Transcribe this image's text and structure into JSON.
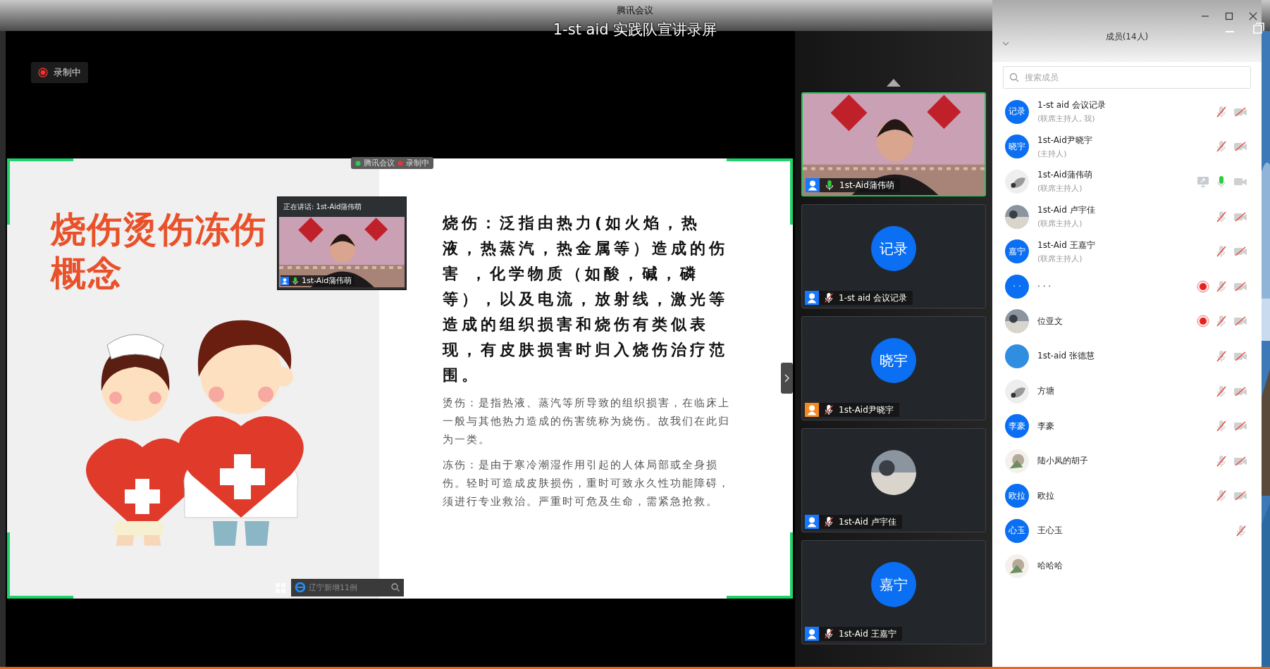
{
  "window": {
    "app_title": "腾讯会议",
    "overlay_title": "1-st aid 实践队宣讲录屏"
  },
  "stage": {
    "recording_badge": "录制中",
    "slide": {
      "title_lines": [
        "烧伤烫伤冻伤",
        "概念"
      ],
      "paragraphs": [
        {
          "kind": "lead",
          "text": "烧伤：泛指由热力(如火焰，热液，热蒸汽，热金属等）造成的伤害 ，化学物质（如酸，碱，磷等），以及电流，放射线，激光等造成的组织损害和烧伤有类似表现，有皮肤损害时归入烧伤治疗范围。"
        },
        {
          "kind": "body",
          "text": "烫伤：是指热液、蒸汽等所导致的组织损害，在临床上一般与其他热力造成的伤害统称为烧伤。故我们在此归为一类。"
        },
        {
          "kind": "body",
          "text": "冻伤：是由于寒冷潮湿作用引起的人体局部或全身损伤。轻时可造成皮肤损伤，重时可致永久性功能障碍，须进行专业救治。严重时可危及生命，需紧急抢救。"
        }
      ]
    },
    "floating_bar": {
      "app": "腾讯会议",
      "status": "录制中"
    },
    "speaker_window": {
      "heading": "正在讲话: 1st-Aid蒲伟萌",
      "name": "1st-Aid蒲伟萌",
      "mic_muted": false
    },
    "taskbar": {
      "search_placeholder": "辽宁新增11例"
    }
  },
  "tiles": [
    {
      "kind": "video",
      "name": "1st-Aid蒲伟萌",
      "mic_muted": false,
      "color": "#1677ff",
      "speaking": true
    },
    {
      "kind": "initials",
      "initials": "记录",
      "name": "1-st aid  会议记录",
      "mic_muted": true,
      "color": "#1677ff",
      "speaking": false
    },
    {
      "kind": "initials",
      "initials": "晓宇",
      "name": "1st-Aid尹晓宇",
      "mic_muted": true,
      "color": "#f5891f",
      "speaking": false
    },
    {
      "kind": "picture",
      "name": "1st-Aid 卢宇佳",
      "mic_muted": true,
      "color": "#1677ff",
      "speaking": false
    },
    {
      "kind": "initials",
      "initials": "嘉宁",
      "name": "1st-Aid 王嘉宁",
      "mic_muted": true,
      "color": "#1677ff",
      "speaking": false
    }
  ],
  "members": {
    "title": "成员(14人)",
    "search": {
      "placeholder": "搜索成员"
    },
    "items": [
      {
        "avatar": {
          "kind": "initials",
          "text": "记录"
        },
        "name": "1-st aid  会议记录",
        "role": "(联席主持人, 我)",
        "sharing": false,
        "recording": false,
        "mic_muted": true,
        "camera_off": true
      },
      {
        "avatar": {
          "kind": "initials",
          "text": "晓宇"
        },
        "name": "1st-Aid尹晓宇",
        "role": "(主持人)",
        "sharing": false,
        "recording": false,
        "mic_muted": true,
        "camera_off": true
      },
      {
        "name": "1st-Aid蒲伟萌",
        "role": "(联席主持人)",
        "sharing": true,
        "recording": false,
        "mic_muted": false,
        "camera_off": false
      },
      {
        "name": "1st-Aid 卢宇佳",
        "role": "(联席主持人)",
        "sharing": false,
        "recording": false,
        "mic_muted": true,
        "camera_off": true
      },
      {
        "avatar": {
          "kind": "initials",
          "text": "嘉宁"
        },
        "name": "1st-Aid 王嘉宁",
        "role": "(联席主持人)",
        "sharing": false,
        "recording": false,
        "mic_muted": true,
        "camera_off": true
      },
      {
        "avatar": {
          "kind": "initials",
          "text": "· ·"
        },
        "name": "· · ·",
        "sharing": false,
        "recording": true,
        "mic_muted": true,
        "camera_off": true
      },
      {
        "name": "位亚文",
        "sharing": false,
        "recording": true,
        "mic_muted": true,
        "camera_off": true
      },
      {
        "avatar": {
          "kind": "plain"
        },
        "name": "1st-aid 张德慧",
        "sharing": false,
        "recording": false,
        "mic_muted": true,
        "camera_off": true
      },
      {
        "name": "方塘",
        "sharing": false,
        "recording": false,
        "mic_muted": true,
        "camera_off": true
      },
      {
        "avatar": {
          "kind": "initials",
          "text": "李豪"
        },
        "name": "李豪",
        "sharing": false,
        "recording": false,
        "mic_muted": true,
        "camera_off": true
      },
      {
        "name": "陆小凤的胡子",
        "sharing": false,
        "recording": false,
        "mic_muted": true,
        "camera_off": true
      },
      {
        "avatar": {
          "kind": "initials",
          "text": "欧拉"
        },
        "name": "欧拉",
        "sharing": false,
        "recording": false,
        "mic_muted": true,
        "camera_off": true
      },
      {
        "avatar": {
          "kind": "initials",
          "text": "心玉"
        },
        "name": "王心玉",
        "sharing": false,
        "recording": false,
        "mic_muted": true
      },
      {
        "name": "哈哈哈",
        "sharing": false,
        "recording": false
      }
    ]
  }
}
